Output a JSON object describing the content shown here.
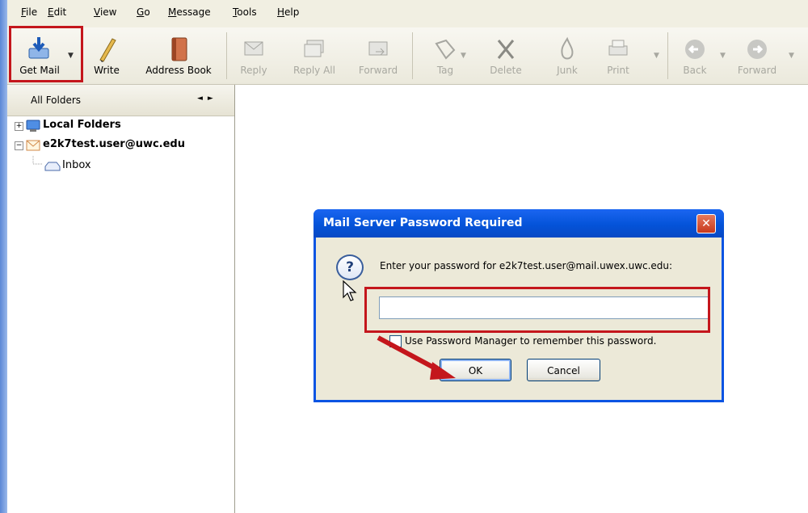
{
  "menubar": {
    "items": [
      "File",
      "Edit",
      "View",
      "Go",
      "Message",
      "Tools",
      "Help"
    ]
  },
  "toolbar": {
    "get_mail": "Get Mail",
    "write": "Write",
    "address_book": "Address Book",
    "reply": "Reply",
    "reply_all": "Reply All",
    "forward": "Forward",
    "tag": "Tag",
    "delete": "Delete",
    "junk": "Junk",
    "print": "Print",
    "back": "Back",
    "forward_nav": "Forward"
  },
  "folder_pane": {
    "header": "All Folders",
    "tree": [
      {
        "label": "Local Folders"
      },
      {
        "label": "e2k7test.user@uwc.edu"
      },
      {
        "label": "Inbox"
      }
    ]
  },
  "dialog": {
    "title": "Mail Server Password Required",
    "prompt": "Enter your password for e2k7test.user@mail.uwex.uwc.edu:",
    "password_value": "",
    "checkbox_label": "Use Password Manager to remember this password.",
    "checkbox_checked": false,
    "ok": "OK",
    "cancel": "Cancel"
  },
  "colors": {
    "highlight": "#c4161c",
    "titlebar": "#0a54e3",
    "dialog_face": "#ece9d8"
  }
}
